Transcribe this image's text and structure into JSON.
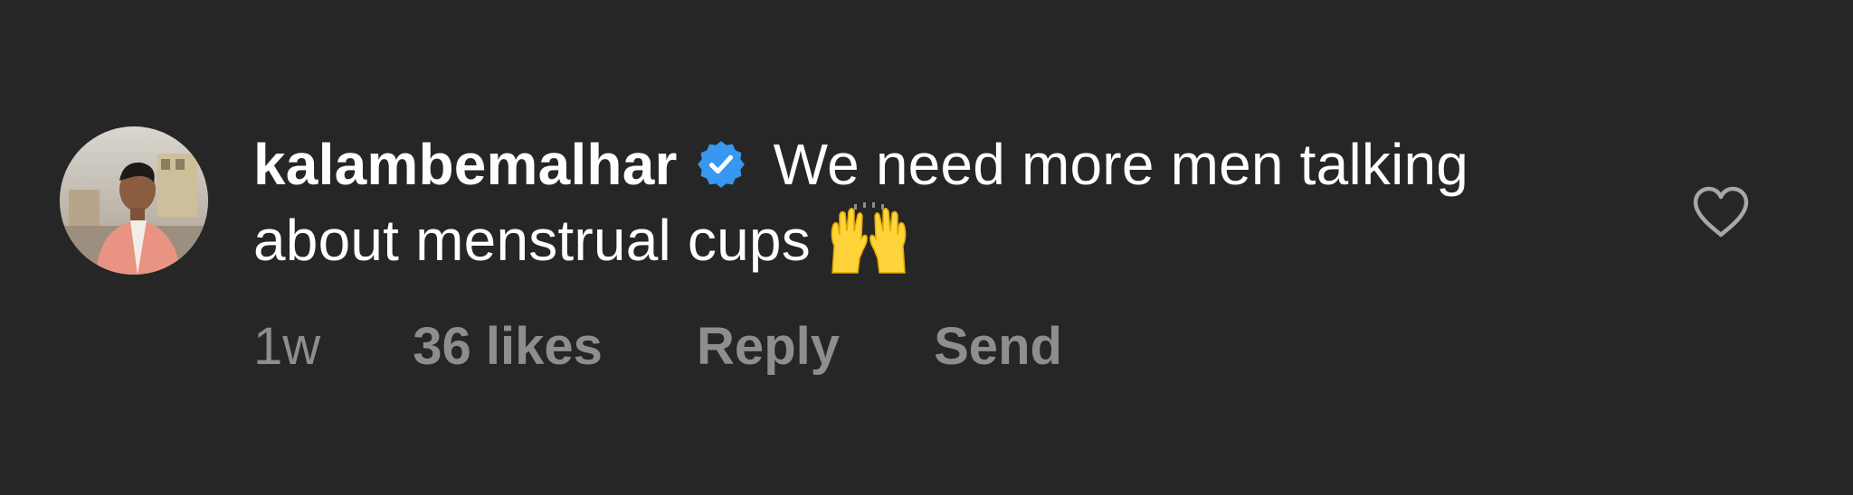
{
  "comment": {
    "username": "kalambemalhar",
    "verified": true,
    "text": " We need more men talking about menstrual cups",
    "emoji": "raising-hands-emoji",
    "timestamp": "1w",
    "likes": "36 likes",
    "reply_label": "Reply",
    "send_label": "Send"
  },
  "icons": {
    "verified": "verified-badge-icon",
    "like": "heart-outline-icon"
  },
  "colors": {
    "background": "#262626",
    "text": "#ffffff",
    "meta": "#8e8e8e",
    "verified": "#3897f0"
  }
}
